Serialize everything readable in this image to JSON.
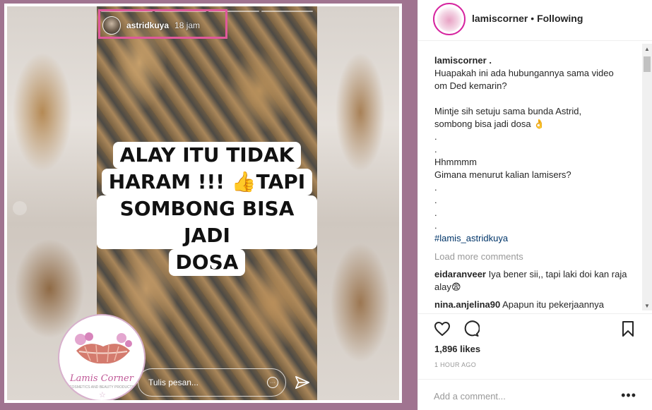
{
  "story": {
    "username": "astridkuya",
    "time": "18 jam",
    "caption_lines": [
      "ALAY ITU TIDAK",
      "HARAM !!! 👍TAPI",
      "SOMBONG BISA JADI",
      "DOSA"
    ],
    "reply_placeholder": "Tulis pesan...",
    "reply_more": "···"
  },
  "watermark": {
    "title": "Lamis Corner",
    "subtitle": "COSMETICS AND BEAUTY PRODUCTS"
  },
  "post": {
    "username": "lamiscorner",
    "separator": " • ",
    "follow_status": "Following",
    "caption_author": "lamiscorner .",
    "caption_lines": [
      "Huapakah ini ada hubungannya sama video",
      "om Ded kemarin?",
      "",
      "Mintje sih setuju sama bunda Astrid,",
      "sombong bisa jadi dosa 👌",
      ".",
      ".",
      "Hhmmmm",
      "Gimana menurut kalian lamisers?",
      ".",
      ".",
      ".",
      "."
    ],
    "hashtag": "#lamis_astridkuya",
    "load_more": "Load more comments",
    "comments": [
      {
        "user": "eidaranveer",
        "text": "Iya bener sii,, tapi laki doi kan raja alay😨"
      },
      {
        "user": "nina.anjelina90",
        "text": "Apapun itu pekerjaannya"
      }
    ],
    "likes": "1,896 likes",
    "time_ago": "1 HOUR AGO",
    "comment_placeholder": "Add a comment...",
    "more": "•••"
  },
  "icons": [
    "heart-icon",
    "comment-icon",
    "bookmark-icon",
    "send-icon",
    "scroll-up-icon",
    "scroll-down-icon"
  ],
  "colors": {
    "highlight_box": "#e0599b",
    "background": "#a07490",
    "hashtag": "#003569"
  }
}
